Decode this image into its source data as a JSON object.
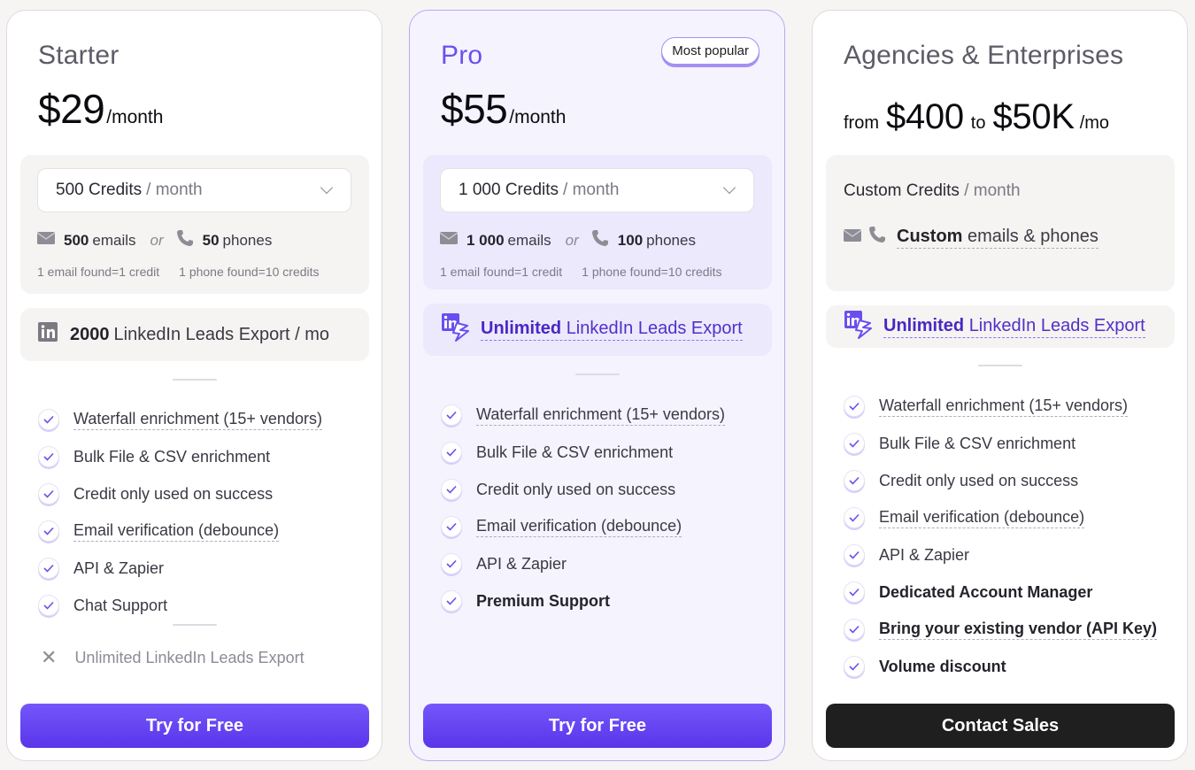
{
  "colors": {
    "accent": "#6a4ff0",
    "cta_gradient_top": "#7457fb",
    "cta_gradient_bottom": "#5a35ea",
    "dark_cta": "#1f1f1f",
    "page_bg": "#f6f5f3"
  },
  "plans": [
    {
      "name": "Starter",
      "price": "$29",
      "period": "/month",
      "credits_select": {
        "amount": "500 Credits",
        "unit": "/ month"
      },
      "emails": {
        "count": "500",
        "label": "emails"
      },
      "or_label": "or",
      "phones": {
        "count": "50",
        "label": "phones"
      },
      "note_email": "1 email found=1 credit",
      "note_phone": "1 phone found=10 credits",
      "linkedin": {
        "count": "2000",
        "label": "LinkedIn Leads Export / mo",
        "icon": "linkedin-icon"
      },
      "features": [
        {
          "label": "Waterfall enrichment  (15+ vendors)"
        },
        {
          "label": "Bulk File & CSV enrichment"
        },
        {
          "label": "Credit only used on success"
        },
        {
          "label": "Email verification (debounce)"
        },
        {
          "label": "API & Zapier"
        },
        {
          "label": "Chat Support"
        }
      ],
      "excluded": [
        {
          "label": "Unlimited LinkedIn Leads Export"
        }
      ],
      "cta": "Try for Free"
    },
    {
      "name": "Pro",
      "badge": "Most popular",
      "price": "$55",
      "period": "/month",
      "credits_select": {
        "amount": "1 000 Credits",
        "unit": "/ month"
      },
      "emails": {
        "count": "1 000",
        "label": "emails"
      },
      "or_label": "or",
      "phones": {
        "count": "100",
        "label": "phones"
      },
      "note_email": "1 email found=1 credit",
      "note_phone": "1 phone found=10 credits",
      "linkedin": {
        "strong": "Unlimited",
        "label": "LinkedIn Leads Export",
        "icon": "linkedin-lightning-icon"
      },
      "features": [
        {
          "label": "Waterfall enrichment  (15+ vendors)"
        },
        {
          "label": "Bulk File & CSV enrichment"
        },
        {
          "label": "Credit only used on success"
        },
        {
          "label": "Email verification (debounce)"
        },
        {
          "label": "API & Zapier"
        },
        {
          "label": "Premium Support"
        }
      ],
      "cta": "Try for Free"
    },
    {
      "name": "Agencies & Enterprises",
      "price_from_label": "from",
      "price_from": "$400",
      "price_to_label": "to",
      "price_to": "$50K",
      "period": "/mo",
      "credits_title": {
        "amount": "Custom Credits",
        "unit": "/ month"
      },
      "custom_contacts": {
        "strong": "Custom",
        "label": "emails & phones"
      },
      "linkedin": {
        "strong": "Unlimited",
        "label": "LinkedIn Leads Export",
        "icon": "linkedin-lightning-icon"
      },
      "features": [
        {
          "label": "Waterfall enrichment  (15+ vendors)"
        },
        {
          "label": "Bulk File & CSV enrichment"
        },
        {
          "label": "Credit only used on success"
        },
        {
          "label": "Email verification (debounce)"
        },
        {
          "label": "API & Zapier"
        },
        {
          "label": "Dedicated Account Manager"
        },
        {
          "label": "Bring your existing vendor (API Key)"
        },
        {
          "label": "Volume discount"
        }
      ],
      "cta": "Contact Sales"
    }
  ]
}
